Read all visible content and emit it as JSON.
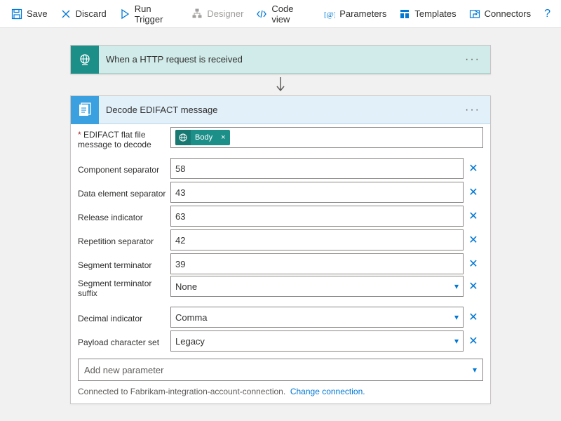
{
  "toolbar": {
    "save": "Save",
    "discard": "Discard",
    "run_trigger": "Run Trigger",
    "designer": "Designer",
    "code_view": "Code view",
    "parameters": "Parameters",
    "templates": "Templates",
    "connectors": "Connectors"
  },
  "trigger": {
    "title": "When a HTTP request is received"
  },
  "action": {
    "title": "Decode EDIFACT message",
    "fields": {
      "msg_label": "EDIFACT flat file message to decode",
      "msg_token": "Body",
      "comp_sep_label": "Component separator",
      "comp_sep_value": "58",
      "data_sep_label": "Data element separator",
      "data_sep_value": "43",
      "release_label": "Release indicator",
      "release_value": "63",
      "rep_sep_label": "Repetition separator",
      "rep_sep_value": "42",
      "seg_term_label": "Segment terminator",
      "seg_term_value": "39",
      "seg_suffix_label": "Segment terminator suffix",
      "seg_suffix_value": "None",
      "decimal_label": "Decimal indicator",
      "decimal_value": "Comma",
      "charset_label": "Payload character set",
      "charset_value": "Legacy"
    },
    "add_param": "Add new parameter",
    "connection_text": "Connected to Fabrikam-integration-account-connection.",
    "change_connection": "Change connection."
  }
}
